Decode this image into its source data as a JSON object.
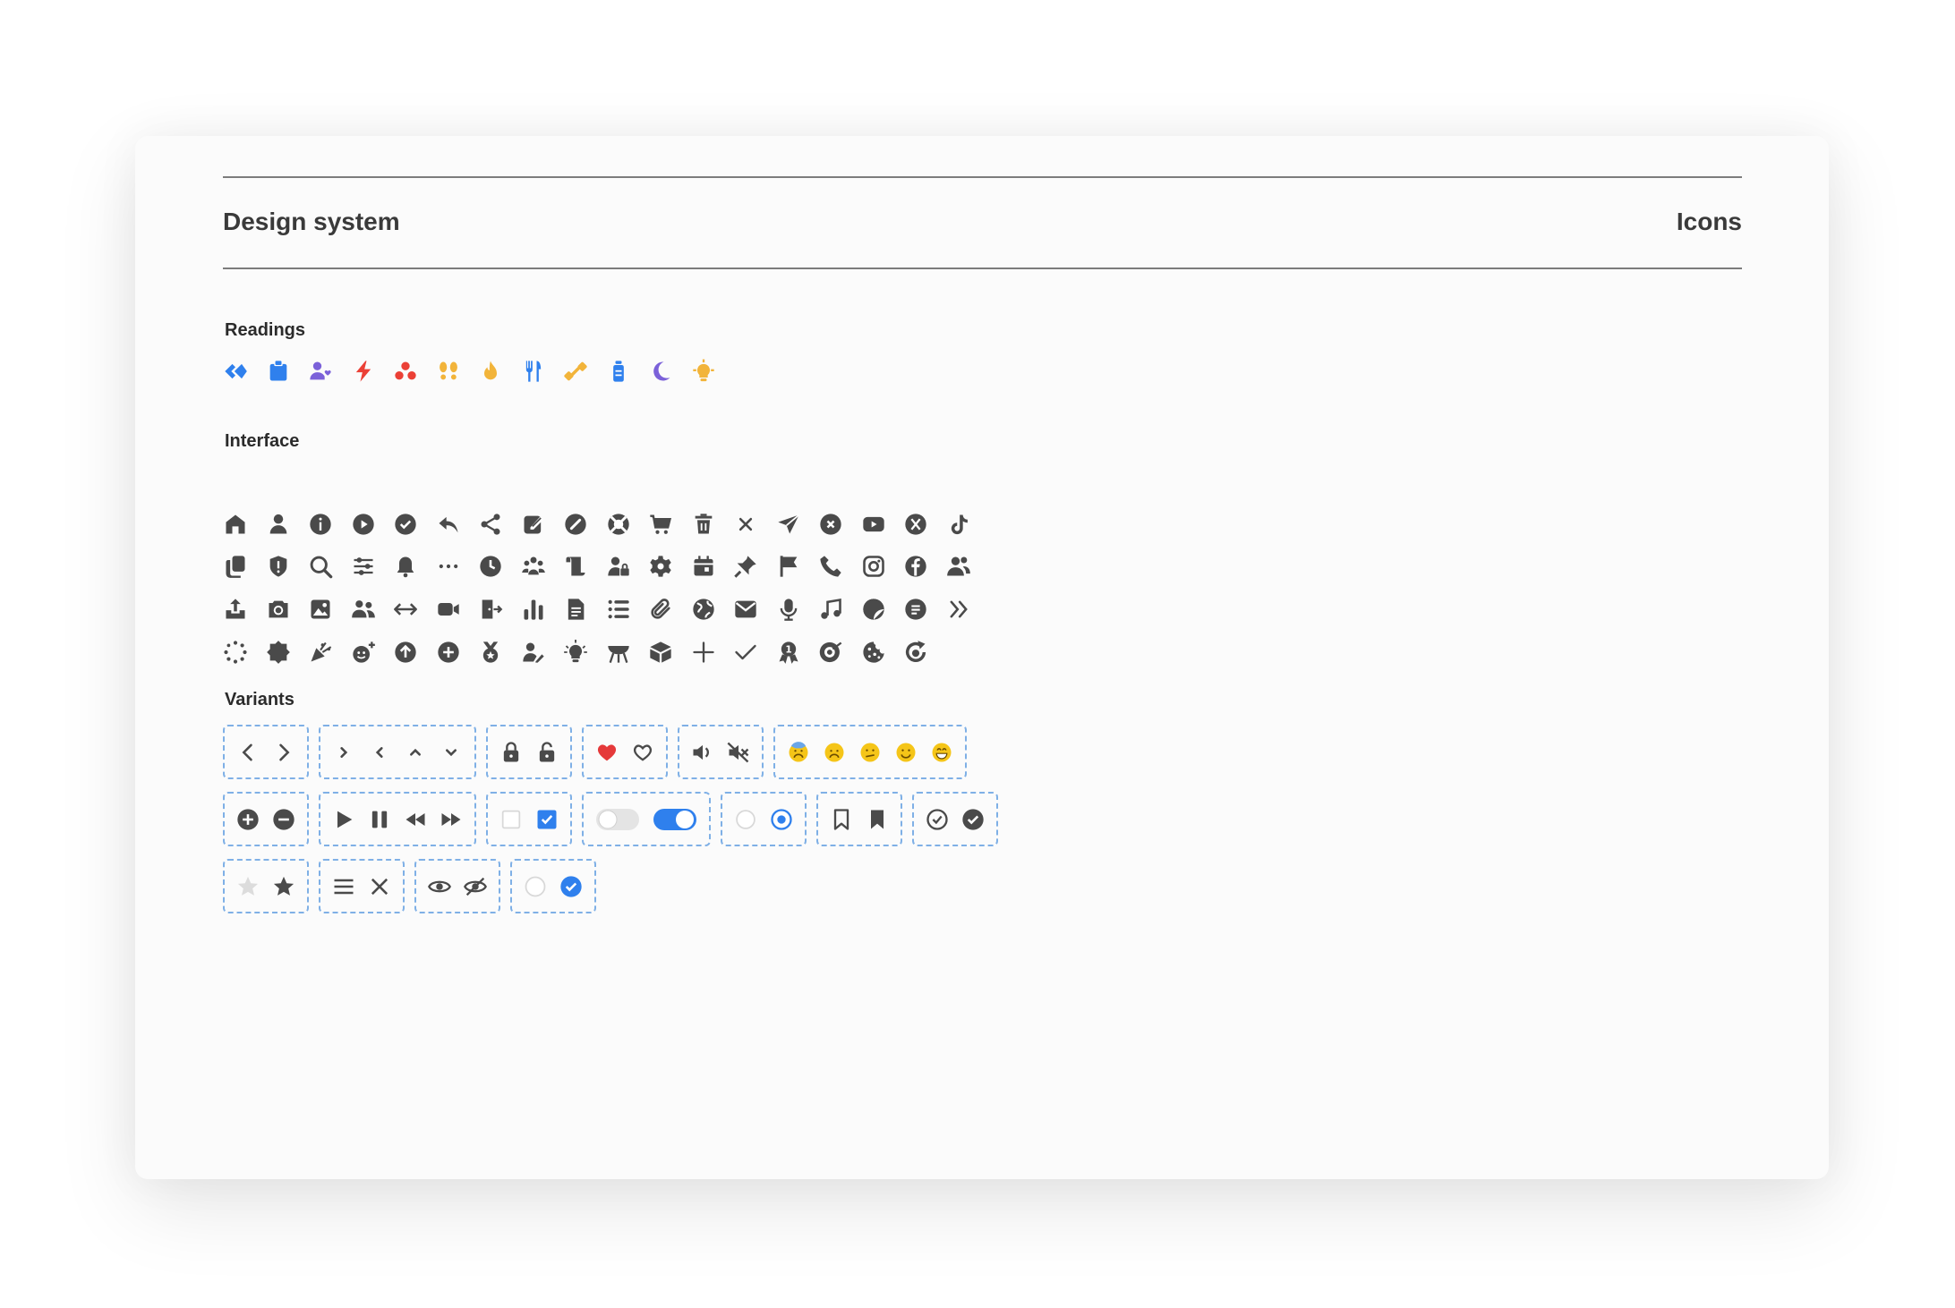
{
  "header": {
    "title": "Design system",
    "section": "Icons"
  },
  "readings": {
    "title": "Readings",
    "icons": [
      {
        "name": "chevrons-right-icon",
        "color": "#2f80ed"
      },
      {
        "name": "clipboard-icon",
        "color": "#2f80ed"
      },
      {
        "name": "user-heart-icon",
        "color": "#7b61d9"
      },
      {
        "name": "lightning-icon",
        "color": "#eb4036"
      },
      {
        "name": "droplets-icon",
        "color": "#eb4036"
      },
      {
        "name": "footprints-icon",
        "color": "#f2b43a"
      },
      {
        "name": "flame-icon",
        "color": "#f2b43a"
      },
      {
        "name": "fork-knife-icon",
        "color": "#2f80ed"
      },
      {
        "name": "dumbbell-icon",
        "color": "#f2b43a"
      },
      {
        "name": "water-bottle-icon",
        "color": "#2f80ed"
      },
      {
        "name": "moon-icon",
        "color": "#7b61d9"
      },
      {
        "name": "lightbulb-icon",
        "color": "#f2b43a"
      }
    ]
  },
  "interface": {
    "title": "Interface",
    "color": "#4a4a4a",
    "rows": [
      [
        "home-icon",
        "user-icon",
        "info-icon",
        "play-circle-icon",
        "check-circle-icon",
        "reply-icon",
        "share-icon",
        "edit-icon",
        "link-icon",
        "lifebuoy-icon",
        "cart-icon",
        "trash-icon",
        "close-icon",
        "send-icon",
        "close-circle-icon",
        "youtube-icon",
        "x-logo-icon",
        "tiktok-icon"
      ],
      [
        "copy-icon",
        "shield-alert-icon",
        "search-icon",
        "sliders-icon",
        "bell-icon",
        "more-horizontal-icon",
        "clock-icon",
        "group-icon",
        "scroll-icon",
        "user-lock-icon",
        "gear-icon",
        "calendar-icon",
        "pin-icon",
        "flag-icon",
        "phone-icon",
        "instagram-icon",
        "facebook-icon",
        "users-icon"
      ],
      [
        "upload-icon",
        "camera-icon",
        "image-icon",
        "users-2-icon",
        "arrows-horizontal-icon",
        "video-icon",
        "door-exit-icon",
        "bar-chart-icon",
        "document-icon",
        "list-icon",
        "paperclip-icon",
        "globe-icon",
        "mail-icon",
        "microphone-icon",
        "music-icon",
        "sticker-icon",
        "message-icon",
        "chevrons-double-right-icon"
      ],
      [
        "loader-icon",
        "badge-icon",
        "confetti-icon",
        "emoji-plus-icon",
        "arrow-up-circle-icon",
        "plus-circle-icon",
        "medal-icon",
        "user-edit-icon",
        "idea-icon",
        "grill-icon",
        "box-icon",
        "plus-icon",
        "check-icon",
        "award-icon",
        "target-icon",
        "cookie-icon",
        "refresh-icon"
      ]
    ]
  },
  "variants": {
    "title": "Variants",
    "rows": [
      [
        {
          "name": "chevron-left-right",
          "icons": [
            "chevron-left-icon",
            "chevron-right-icon"
          ]
        },
        {
          "name": "small-chevrons",
          "icons": [
            "chevron-right-small-icon",
            "chevron-left-small-icon",
            "chevron-up-icon",
            "chevron-down-icon"
          ]
        },
        {
          "name": "lock-states",
          "icons": [
            "lock-icon",
            "unlock-icon"
          ]
        },
        {
          "name": "heart-states",
          "icons": [
            "heart-filled-icon",
            "heart-outline-icon"
          ]
        },
        {
          "name": "volume-states",
          "icons": [
            "volume-icon",
            "mute-icon"
          ]
        },
        {
          "name": "mood-scale",
          "icons": [
            "sad-face-icon",
            "worried-face-icon",
            "confused-face-icon",
            "smile-face-icon",
            "grin-face-icon"
          ]
        }
      ],
      [
        {
          "name": "plus-minus",
          "icons": [
            "plus-circle-icon",
            "minus-circle-icon"
          ]
        },
        {
          "name": "media-controls",
          "icons": [
            "play-icon",
            "pause-icon",
            "rewind-icon",
            "fast-forward-icon"
          ]
        },
        {
          "name": "checkbox-states",
          "icons": [
            "checkbox-empty-icon",
            "checkbox-checked-icon"
          ]
        },
        {
          "name": "toggle-states",
          "icons": [
            "toggle-off-icon",
            "toggle-on-icon"
          ]
        },
        {
          "name": "radio-states",
          "icons": [
            "radio-empty-icon",
            "radio-selected-icon"
          ]
        },
        {
          "name": "bookmark-states",
          "icons": [
            "bookmark-outline-icon",
            "bookmark-filled-icon"
          ]
        },
        {
          "name": "check-circle-states",
          "icons": [
            "check-circle-outline-icon",
            "check-circle-filled-icon"
          ]
        }
      ],
      [
        {
          "name": "star-states",
          "icons": [
            "star-empty-icon",
            "star-filled-icon"
          ]
        },
        {
          "name": "menu-close",
          "icons": [
            "menu-icon",
            "close-x-icon"
          ]
        },
        {
          "name": "visibility-states",
          "icons": [
            "eye-icon",
            "eye-off-icon"
          ]
        },
        {
          "name": "round-check-states",
          "icons": [
            "round-empty-icon",
            "round-checked-icon"
          ]
        }
      ]
    ]
  }
}
